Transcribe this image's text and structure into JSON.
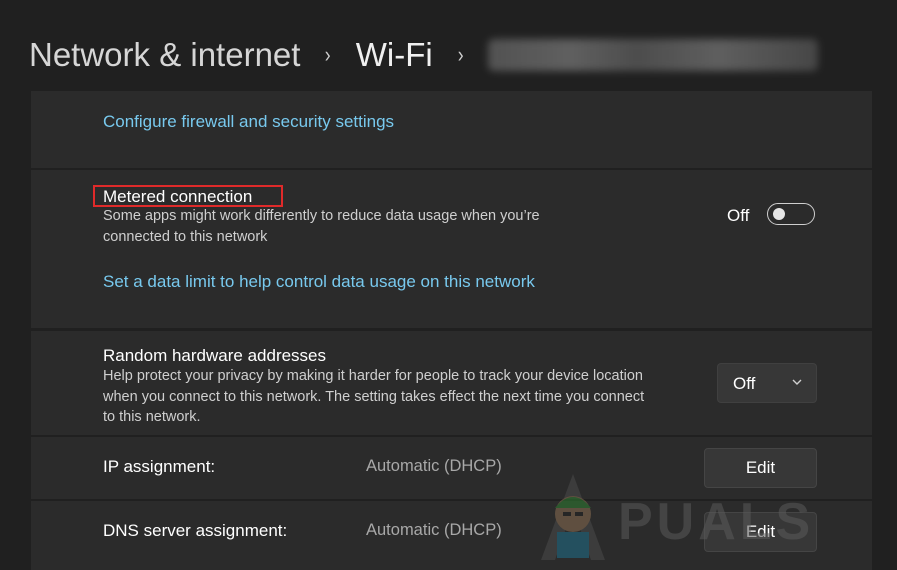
{
  "header": {
    "breadcrumb": [
      "Network & internet",
      "Wi-Fi"
    ],
    "separator": "›",
    "network_name_blurred": true
  },
  "firewall": {
    "link": "Configure firewall and security settings"
  },
  "metered": {
    "title": "Metered connection",
    "description_line1": "Some apps might work differently to reduce data usage when you’re",
    "description_line2": "connected to this network",
    "toggle_state": "Off",
    "toggle_on": false,
    "link": "Set a data limit to help control data usage on this network"
  },
  "random_hw": {
    "title": "Random hardware addresses",
    "description_line1": "Help protect your privacy by making it harder for people to track your device location",
    "description_line2": "when you connect to this network. The setting takes effect the next time you connect",
    "description_line3": "to this network.",
    "dropdown_value": "Off"
  },
  "ip": {
    "label": "IP assignment:",
    "value": "Automatic (DHCP)",
    "button": "Edit"
  },
  "dns": {
    "label": "DNS server assignment:",
    "value": "Automatic (DHCP)",
    "button": "Edit"
  },
  "watermark": {
    "text": "A PUALS"
  },
  "colors": {
    "background": "#202020",
    "panel": "#2b2b2b",
    "link": "#78c9ee",
    "highlight": "#e02a2a"
  },
  "icons": {
    "separator": "chevron-right-icon",
    "dropdown": "chevron-down-icon",
    "toggle": "toggle-switch-icon"
  }
}
